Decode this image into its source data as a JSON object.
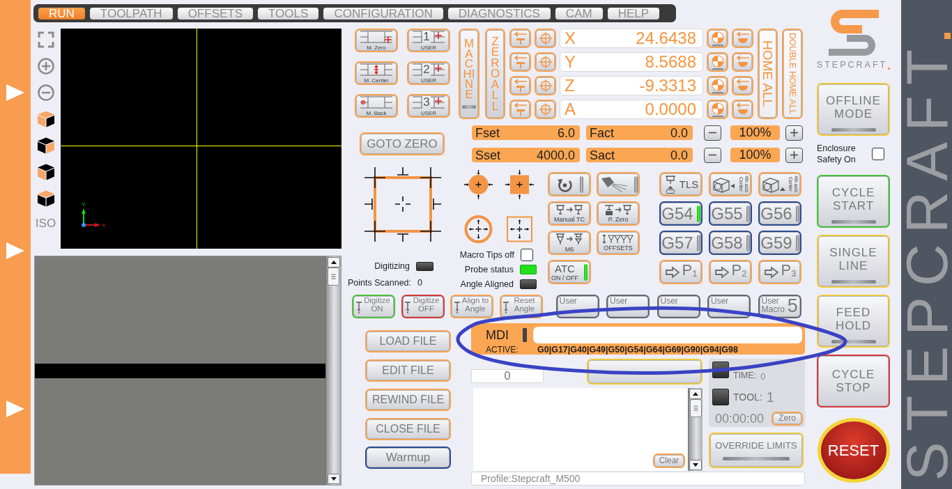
{
  "tabs": [
    {
      "label": "RUN",
      "selected": true
    },
    {
      "label": "TOOLPATH",
      "selected": false
    },
    {
      "label": "OFFSETS",
      "selected": false
    },
    {
      "label": "TOOLS",
      "selected": false
    },
    {
      "label": "CONFIGURATION",
      "selected": false
    },
    {
      "label": "DIAGNOSTICS",
      "selected": false
    },
    {
      "label": "CAM",
      "selected": false
    },
    {
      "label": "HELP",
      "selected": false
    }
  ],
  "view_toolbar": {
    "iso_label": "ISO"
  },
  "toolpath_view": {
    "axis_y_label": "Y",
    "axis_x_label": "X"
  },
  "reference_buttons": [
    {
      "kind": "machine",
      "caption": "M. Zero"
    },
    {
      "kind": "user",
      "number": "1",
      "caption": "USER"
    },
    {
      "kind": "machine",
      "caption": "M. Center"
    },
    {
      "kind": "user",
      "number": "2",
      "caption": "USER"
    },
    {
      "kind": "machine",
      "caption": "M. Back"
    },
    {
      "kind": "user",
      "number": "3",
      "caption": "USER"
    }
  ],
  "goto_zero_button": {
    "label": "GOTO ZERO"
  },
  "machine_button": {
    "label": "MACHINE",
    "on": false
  },
  "zero_all_button": {
    "label": "ZERO ALL"
  },
  "axes": [
    {
      "axis": "X",
      "value": "24.6438"
    },
    {
      "axis": "Y",
      "value": "8.5688"
    },
    {
      "axis": "Z",
      "value": "-9.3313"
    },
    {
      "axis": "A",
      "value": "0.0000"
    }
  ],
  "home_all_button": {
    "label": "HOME ALL"
  },
  "double_home_all_button": {
    "label": "DOUBLE HOME ALL"
  },
  "rates": [
    {
      "set_label": "Fset",
      "set_value": "6.0",
      "actual_label": "Fact",
      "actual_value": "0.0",
      "override": "100%"
    },
    {
      "set_label": "Sset",
      "set_value": "4000.0",
      "actual_label": "Sact",
      "actual_value": "0.0",
      "override": "100%"
    }
  ],
  "digitizing": {
    "label": "Digitizing",
    "on": false
  },
  "points_scanned": {
    "label": "Points Scanned:",
    "value": "0"
  },
  "macro_tips": {
    "label": "Macro Tips off",
    "checked": false
  },
  "probe_indicators": [
    {
      "label": "Probe status",
      "on": true
    },
    {
      "label": "Angle Aligned",
      "on": false
    }
  ],
  "tool_buttons": [
    {
      "kind": "rotate",
      "on": false
    },
    {
      "kind": "spray",
      "on": false
    },
    {
      "kind": "manual_tc",
      "caption": "Manual TC"
    },
    {
      "kind": "probe_zero",
      "caption": "P. Zero"
    },
    {
      "kind": "m6",
      "caption": "M6"
    },
    {
      "kind": "offsets",
      "caption": "OFFSETS"
    },
    {
      "kind": "atc",
      "label": "ATC",
      "caption": "ON / OFF",
      "on": true
    }
  ],
  "setup_buttons": [
    {
      "kind": "tls",
      "label": "TLS"
    },
    {
      "kind": "axis4",
      "caption": "4th axis Center"
    },
    {
      "kind": "axis4",
      "caption": "4th axis Center"
    }
  ],
  "work_offsets": [
    {
      "label": "G54",
      "active": true
    },
    {
      "label": "G55",
      "active": false
    },
    {
      "label": "G56",
      "active": false
    },
    {
      "label": "G57",
      "active": false
    },
    {
      "label": "G58",
      "active": false
    },
    {
      "label": "G59",
      "active": false
    }
  ],
  "positions": [
    {
      "label": "P$_{1}$"
    },
    {
      "label": "P$_{2}$"
    },
    {
      "label": "P$_{3}$"
    }
  ],
  "probe_actions": [
    {
      "kind": "start",
      "label": "Digitize ON"
    },
    {
      "kind": "stop",
      "label": "Digitize OFF"
    },
    {
      "kind": "action",
      "label": "Align to Angle"
    },
    {
      "kind": "action",
      "label": "Reset Angle"
    }
  ],
  "user_macros": [
    {
      "label": "User"
    },
    {
      "label": "User"
    },
    {
      "label": "User"
    },
    {
      "label": "User"
    },
    {
      "label": "User Macro",
      "number": "5"
    }
  ],
  "file_buttons": [
    {
      "label": "LOAD FILE"
    },
    {
      "label": "EDIT FILE"
    },
    {
      "label": "REWIND FILE"
    },
    {
      "label": "CLOSE FILE"
    }
  ],
  "warmup_button": {
    "label": "Warmup"
  },
  "mdi": {
    "label": "MDI",
    "active_label": "ACTIVE:",
    "active_codes": "G0|G17|G40|G49|G50|G54|G64|G69|G90|G94|G98"
  },
  "actual_line": {
    "value": "0"
  },
  "messages": {
    "clear_button": "Clear"
  },
  "job_info": {
    "dwell": {
      "label": "TIME:",
      "value": "0",
      "on": false
    },
    "tool": {
      "label": "TOOL:",
      "value": "1",
      "on": false
    },
    "timer": "00:00:00",
    "zero_button": "Zero"
  },
  "override_limits_button": {
    "label": "OVERRIDE LIMITS",
    "on": false
  },
  "profile": "Profile:Stepcraft_M500",
  "logo": {
    "wordmark": "STEPCRAFT"
  },
  "offline_mode_button": {
    "label": "OFFLINE MODE",
    "on": false
  },
  "enclosure_safety": {
    "label": "Enclosure Safety On",
    "checked": false
  },
  "cycle_buttons": [
    {
      "kind": "start",
      "label": "CYCLE START",
      "on": false
    },
    {
      "kind": "toggle",
      "label": "SINGLE LINE",
      "on": false
    },
    {
      "kind": "toggle",
      "label": "FEED HOLD",
      "on": false
    },
    {
      "kind": "stop",
      "label": "CYCLE STOP"
    }
  ],
  "reset_button": {
    "label": "RESET"
  },
  "brand_band": {
    "text": "STEPCRAFT"
  },
  "annotations": [
    {
      "kind": "ellipse"
    }
  ]
}
